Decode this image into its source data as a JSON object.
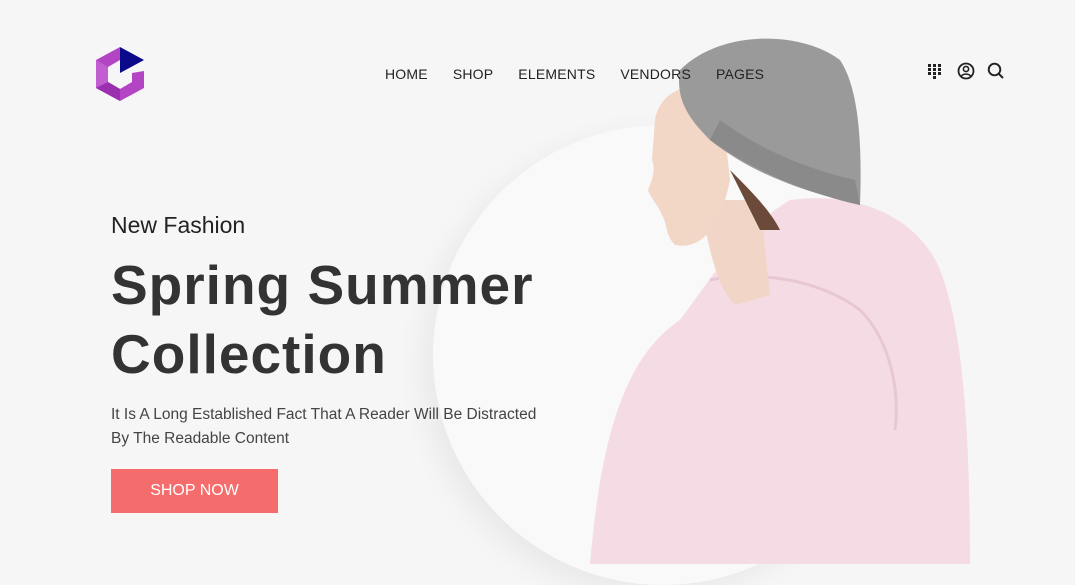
{
  "nav": {
    "items": [
      "HOME",
      "SHOP",
      "ELEMENTS",
      "VENDORS",
      "PAGES"
    ]
  },
  "header_icons": [
    "grid-icon",
    "user-icon",
    "search-icon"
  ],
  "hero": {
    "eyebrow": "New Fashion",
    "title_line1": "Spring Summer",
    "title_line2": "Collection",
    "description": "It Is A Long Established Fact That A Reader Will Be Distracted By The Readable Content",
    "cta": "SHOP NOW"
  },
  "colors": {
    "accent": "#f56c6c",
    "logo_purple": "#b344c4",
    "logo_navy": "#0a0a8a"
  }
}
